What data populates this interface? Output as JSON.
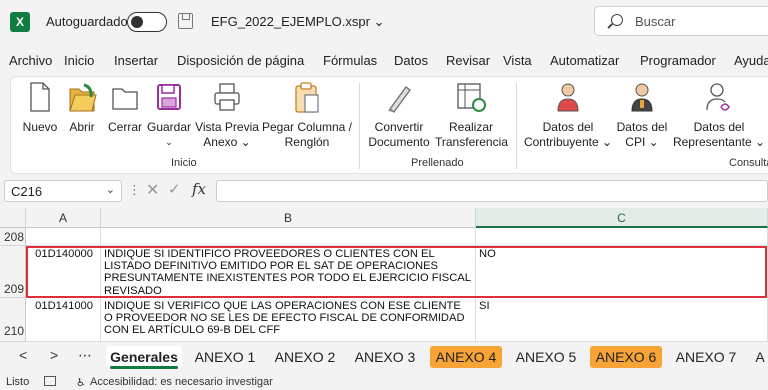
{
  "titlebar": {
    "logo": "X",
    "autosave_label": "Autoguardado",
    "filename": "EFG_2022_EJEMPLO.xspr ⌄",
    "search_placeholder": "Buscar"
  },
  "menu": [
    "Archivo",
    "Inicio",
    "Insertar",
    "Disposición de página",
    "Fórmulas",
    "Datos",
    "Revisar",
    "Vista",
    "Automatizar",
    "Programador",
    "Ayuda"
  ],
  "ribbon": {
    "buttons": [
      {
        "label1": "Nuevo",
        "label2": "",
        "icon": "new-document-icon"
      },
      {
        "label1": "Abrir",
        "label2": "",
        "icon": "open-folder-icon"
      },
      {
        "label1": "Cerrar",
        "label2": "",
        "icon": "close-folder-icon"
      },
      {
        "label1": "Guardar",
        "label2": "⌄",
        "icon": "save-icon"
      },
      {
        "label1": "Vista Previa",
        "label2": "Anexo ⌄",
        "icon": "print-preview-icon"
      },
      {
        "label1": "Pegar Columna /",
        "label2": "Renglón",
        "icon": "paste-icon"
      },
      {
        "label1": "Convertir",
        "label2": "Documento",
        "icon": "convert-document-icon"
      },
      {
        "label1": "Realizar",
        "label2": "Transferencia",
        "icon": "transfer-icon"
      },
      {
        "label1": "Datos del",
        "label2": "Contribuyente ⌄",
        "icon": "taxpayer-icon"
      },
      {
        "label1": "Datos del",
        "label2": "CPI ⌄",
        "icon": "cpi-icon"
      },
      {
        "label1": "Datos del",
        "label2": "Representante ⌄",
        "icon": "representative-icon"
      }
    ],
    "groups": {
      "inicio": "Inicio",
      "prellenado": "Prellenado",
      "consulta": "Consulta"
    }
  },
  "formula_bar": {
    "name_box": "C216",
    "chevron": "⌄",
    "dots": "⋮",
    "cancel": "✕",
    "confirm": "✓",
    "fx": "fx",
    "value": ""
  },
  "columns": [
    "A",
    "B",
    "C"
  ],
  "rows": [
    {
      "num": "208",
      "a": "",
      "b": "",
      "c": ""
    },
    {
      "num": "209",
      "a": "01D140000",
      "b": "INDIQUE SI IDENTIFICO PROVEEDORES O CLIENTES CON EL LISTADO DEFINITIVO EMITIDO POR EL SAT DE OPERACIONES PRESUNTAMENTE INEXISTENTES POR TODO EL EJERCICIO FISCAL REVISADO",
      "c": "NO"
    },
    {
      "num": "210",
      "a": "01D141000",
      "b": "INDIQUE SI VERIFICO QUE LAS OPERACIONES CON ESE CLIENTE O PROVEEDOR NO SE LES DE EFECTO FISCAL DE CONFORMIDAD CON EL ARTÍCULO 69-B DEL CFF",
      "c": "SI"
    }
  ],
  "sheet_tabs": [
    {
      "label": "Generales",
      "state": "active"
    },
    {
      "label": "ANEXO 1",
      "state": "normal"
    },
    {
      "label": "ANEXO 2",
      "state": "normal"
    },
    {
      "label": "ANEXO 3",
      "state": "normal"
    },
    {
      "label": "ANEXO 4",
      "state": "orange"
    },
    {
      "label": "ANEXO 5",
      "state": "normal"
    },
    {
      "label": "ANEXO 6",
      "state": "orange"
    },
    {
      "label": "ANEXO 7",
      "state": "normal"
    },
    {
      "label": "A",
      "state": "normal"
    }
  ],
  "tab_nav": {
    "prev": "<",
    "next": ">",
    "more": "⋯"
  },
  "status": {
    "ready": "Listo",
    "accessibility": "Accesibilidad: es necesario investigar"
  },
  "colors": {
    "excel_green": "#107c41",
    "tab_orange": "#f7a335",
    "selection_red": "#d9303a"
  }
}
